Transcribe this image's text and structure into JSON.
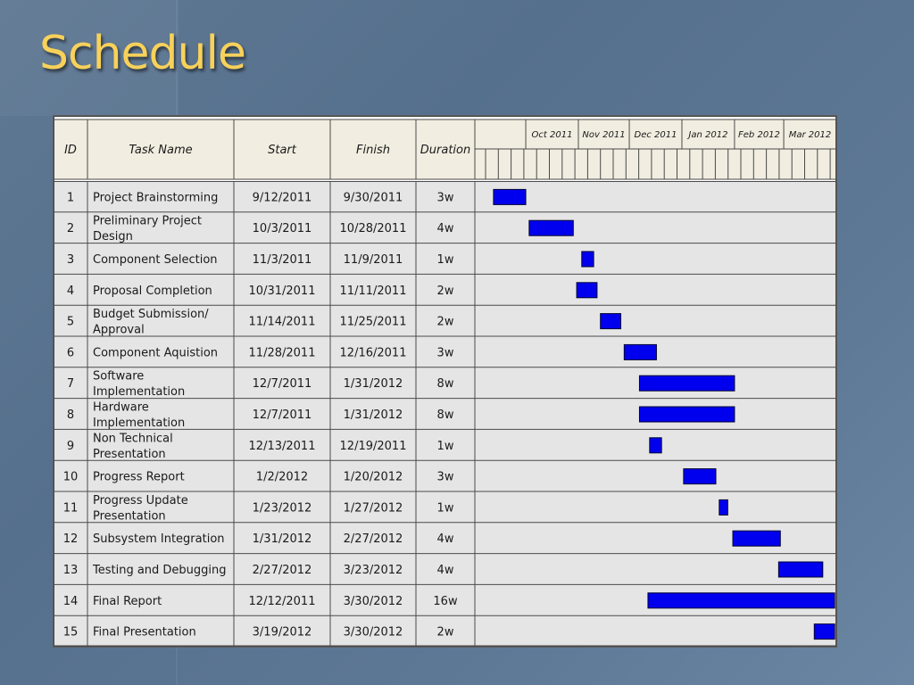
{
  "slide": {
    "title": "Schedule"
  },
  "colors": {
    "title": "#f7d15a",
    "bar": "#0000ee",
    "row_fill": "#e5e5e5",
    "header_fill": "#f1ede0"
  },
  "table": {
    "headers": {
      "id": "ID",
      "task": "Task Name",
      "start": "Start",
      "finish": "Finish",
      "duration": "Duration"
    },
    "months": [
      "Oct 2011",
      "Nov 2011",
      "Dec 2011",
      "Jan 2012",
      "Feb 2012",
      "Mar 2012"
    ]
  },
  "chart_data": {
    "type": "gantt",
    "date_range": [
      "2011-09-01",
      "2012-03-31"
    ],
    "tasks": [
      {
        "id": "1",
        "name": [
          "Project Brainstorming"
        ],
        "start": "9/12/2011",
        "finish": "9/30/2011",
        "duration": "3w",
        "start_iso": "2011-09-12",
        "finish_iso": "2011-09-30"
      },
      {
        "id": "2",
        "name": [
          "Preliminary Project",
          "Design"
        ],
        "start": "10/3/2011",
        "finish": "10/28/2011",
        "duration": "4w",
        "start_iso": "2011-10-03",
        "finish_iso": "2011-10-28"
      },
      {
        "id": "3",
        "name": [
          "Component Selection"
        ],
        "start": "11/3/2011",
        "finish": "11/9/2011",
        "duration": "1w",
        "start_iso": "2011-11-03",
        "finish_iso": "2011-11-09"
      },
      {
        "id": "4",
        "name": [
          "Proposal Completion"
        ],
        "start": "10/31/2011",
        "finish": "11/11/2011",
        "duration": "2w",
        "start_iso": "2011-10-31",
        "finish_iso": "2011-11-11"
      },
      {
        "id": "5",
        "name": [
          "Budget Submission/",
          "Approval"
        ],
        "start": "11/14/2011",
        "finish": "11/25/2011",
        "duration": "2w",
        "start_iso": "2011-11-14",
        "finish_iso": "2011-11-25"
      },
      {
        "id": "6",
        "name": [
          "Component Aquistion"
        ],
        "start": "11/28/2011",
        "finish": "12/16/2011",
        "duration": "3w",
        "start_iso": "2011-11-28",
        "finish_iso": "2011-12-16"
      },
      {
        "id": "7",
        "name": [
          "Software",
          "Implementation"
        ],
        "start": "12/7/2011",
        "finish": "1/31/2012",
        "duration": "8w",
        "start_iso": "2011-12-07",
        "finish_iso": "2012-01-31"
      },
      {
        "id": "8",
        "name": [
          "Hardware",
          "Implementation"
        ],
        "start": "12/7/2011",
        "finish": "1/31/2012",
        "duration": "8w",
        "start_iso": "2011-12-07",
        "finish_iso": "2012-01-31"
      },
      {
        "id": "9",
        "name": [
          "Non Technical",
          "Presentation"
        ],
        "start": "12/13/2011",
        "finish": "12/19/2011",
        "duration": "1w",
        "start_iso": "2011-12-13",
        "finish_iso": "2011-12-19"
      },
      {
        "id": "10",
        "name": [
          "Progress Report"
        ],
        "start": "1/2/2012",
        "finish": "1/20/2012",
        "duration": "3w",
        "start_iso": "2012-01-02",
        "finish_iso": "2012-01-20"
      },
      {
        "id": "11",
        "name": [
          "Progress Update",
          "Presentation"
        ],
        "start": "1/23/2012",
        "finish": "1/27/2012",
        "duration": "1w",
        "start_iso": "2012-01-23",
        "finish_iso": "2012-01-27"
      },
      {
        "id": "12",
        "name": [
          "Subsystem Integration"
        ],
        "start": "1/31/2012",
        "finish": "2/27/2012",
        "duration": "4w",
        "start_iso": "2012-01-31",
        "finish_iso": "2012-02-27"
      },
      {
        "id": "13",
        "name": [
          "Testing and Debugging"
        ],
        "start": "2/27/2012",
        "finish": "3/23/2012",
        "duration": "4w",
        "start_iso": "2012-02-27",
        "finish_iso": "2012-03-23"
      },
      {
        "id": "14",
        "name": [
          "Final Report"
        ],
        "start": "12/12/2011",
        "finish": "3/30/2012",
        "duration": "16w",
        "start_iso": "2011-12-12",
        "finish_iso": "2012-03-30"
      },
      {
        "id": "15",
        "name": [
          "Final Presentation"
        ],
        "start": "3/19/2012",
        "finish": "3/30/2012",
        "duration": "2w",
        "start_iso": "2012-03-19",
        "finish_iso": "2012-03-30"
      }
    ]
  }
}
